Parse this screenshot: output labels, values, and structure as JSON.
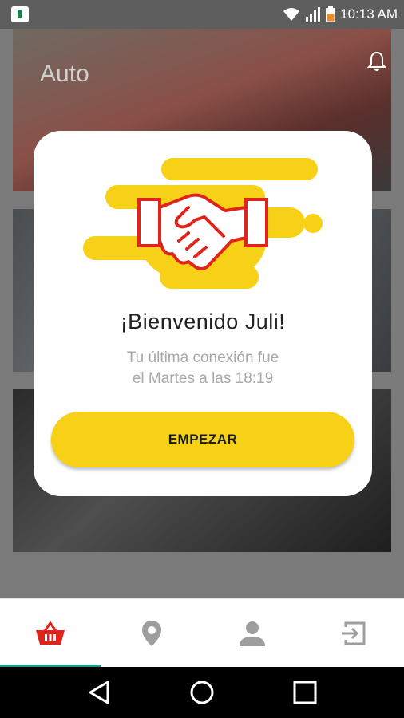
{
  "status_bar": {
    "time": "10:13 AM"
  },
  "background": {
    "category_title": "Auto",
    "icons": {
      "notification": "bell-icon"
    }
  },
  "modal": {
    "illustration": "handshake-icon",
    "welcome": "¡Bienvenido Juli!",
    "last_connection_line1": "Tu última conexión fue",
    "last_connection_line2": "el Martes a las 18:19",
    "start_button": "EMPEZAR"
  },
  "tabs": [
    {
      "icon": "basket-icon",
      "active": true
    },
    {
      "icon": "location-pin-icon",
      "active": false
    },
    {
      "icon": "person-icon",
      "active": false
    },
    {
      "icon": "logout-icon",
      "active": false
    }
  ],
  "colors": {
    "accent_yellow": "#F7D117",
    "active_red": "#E0231B",
    "inactive_gray": "#9E9E9E",
    "indicator_teal": "#1B9E8C"
  },
  "system_nav": [
    "back-icon",
    "home-icon",
    "recents-icon"
  ]
}
